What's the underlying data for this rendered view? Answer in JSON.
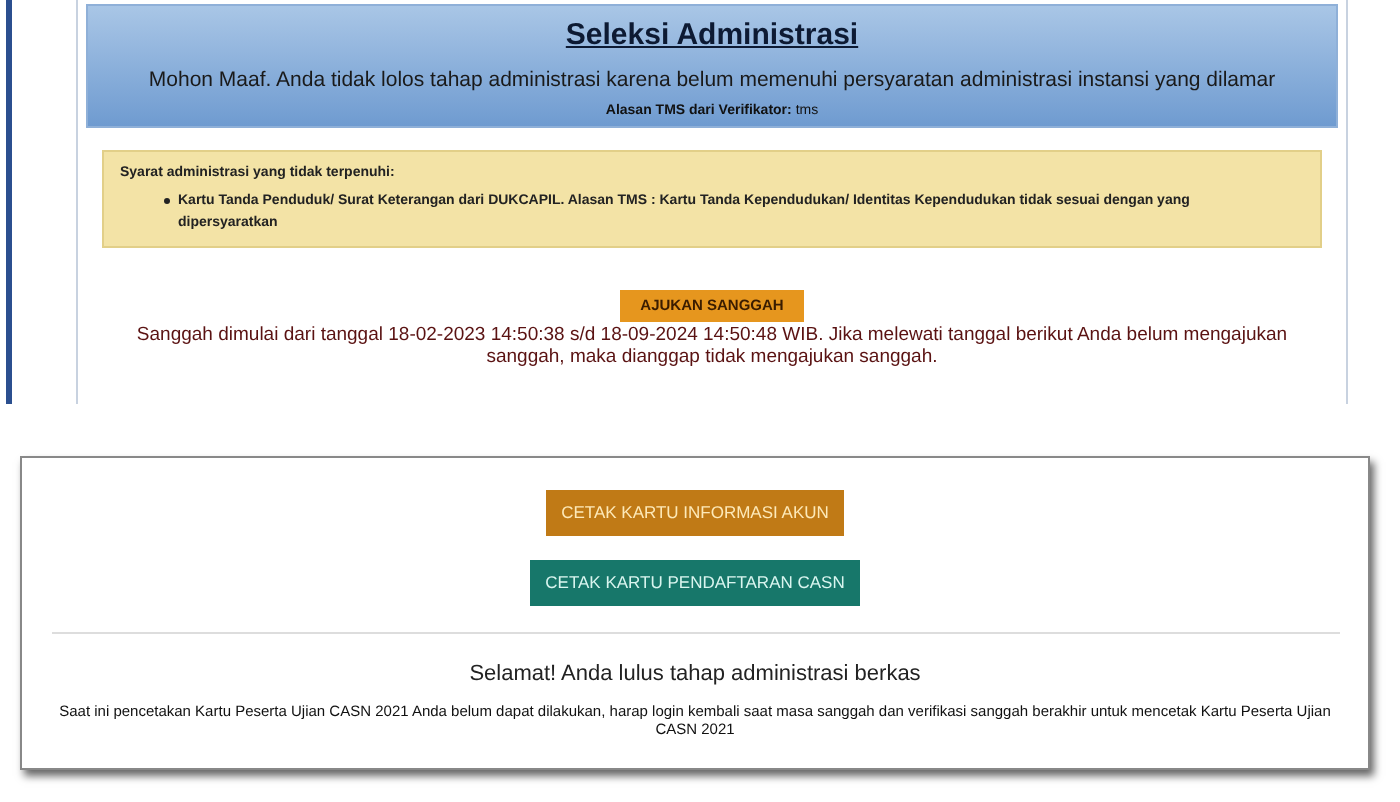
{
  "admin_panel": {
    "title": "Seleksi Administrasi",
    "message": "Mohon Maaf. Anda tidak lolos tahap administrasi karena belum memenuhi persyaratan administrasi instansi yang dilamar",
    "reason_label": "Alasan TMS dari Verifikator:",
    "reason_value": "tms"
  },
  "requirements": {
    "heading": "Syarat administrasi yang tidak terpenuhi:",
    "items": [
      "Kartu Tanda Penduduk/ Surat Keterangan dari DUKCAPIL. Alasan TMS : Kartu Tanda Kependudukan/ Identitas Kependudukan tidak sesuai dengan yang dipersyaratkan"
    ]
  },
  "appeal": {
    "button": "AJUKAN SANGGAH",
    "note": "Sanggah dimulai dari tanggal 18-02-2023 14:50:38 s/d 18-09-2024 14:50:48 WIB. Jika melewati tanggal berikut Anda belum mengajukan sanggah, maka dianggap tidak mengajukan sanggah."
  },
  "print_card": {
    "buttons": [
      {
        "label": "CETAK KARTU INFORMASI AKUN",
        "kind": "orange"
      },
      {
        "label": "CETAK KARTU PENDAFTARAN CASN",
        "kind": "teal"
      }
    ],
    "title": "Selamat! Anda lulus tahap administrasi berkas",
    "note": "Saat ini pencetakan Kartu Peserta Ujian CASN 2021 Anda belum dapat dilakukan, harap login kembali saat masa sanggah dan verifikasi sanggah berakhir untuk mencetak Kartu Peserta Ujian CASN 2021"
  }
}
